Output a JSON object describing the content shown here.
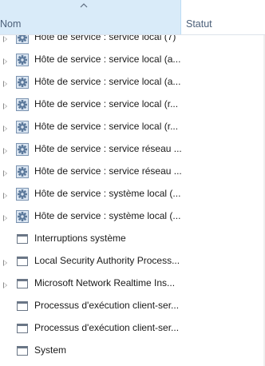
{
  "columns": {
    "name": "Nom",
    "status": "Statut"
  },
  "sort": {
    "column": "name",
    "direction": "ascending"
  },
  "rows": [
    {
      "label": "Hôte de service : service local (7)",
      "icon": "gear-icon",
      "expandable": true
    },
    {
      "label": "Hôte de service : service local (a...",
      "icon": "gear-icon",
      "expandable": true
    },
    {
      "label": "Hôte de service : service local (a...",
      "icon": "gear-icon",
      "expandable": true
    },
    {
      "label": "Hôte de service : service local (r...",
      "icon": "gear-icon",
      "expandable": true
    },
    {
      "label": "Hôte de service : service local (r...",
      "icon": "gear-icon",
      "expandable": true
    },
    {
      "label": "Hôte de service : service réseau ...",
      "icon": "gear-icon",
      "expandable": true
    },
    {
      "label": "Hôte de service : service réseau ...",
      "icon": "gear-icon",
      "expandable": true
    },
    {
      "label": "Hôte de service : système local (...",
      "icon": "gear-icon",
      "expandable": true
    },
    {
      "label": "Hôte de service : système local (...",
      "icon": "gear-icon",
      "expandable": true
    },
    {
      "label": "Interruptions système",
      "icon": "window-icon",
      "expandable": false
    },
    {
      "label": "Local Security Authority Process...",
      "icon": "window-icon",
      "expandable": true
    },
    {
      "label": "Microsoft Network Realtime Ins...",
      "icon": "window-icon",
      "expandable": true
    },
    {
      "label": "Processus d'exécution client-ser...",
      "icon": "window-icon",
      "expandable": false
    },
    {
      "label": "Processus d'exécution client-ser...",
      "icon": "window-icon",
      "expandable": false
    },
    {
      "label": "System",
      "icon": "window-icon",
      "expandable": false
    }
  ]
}
